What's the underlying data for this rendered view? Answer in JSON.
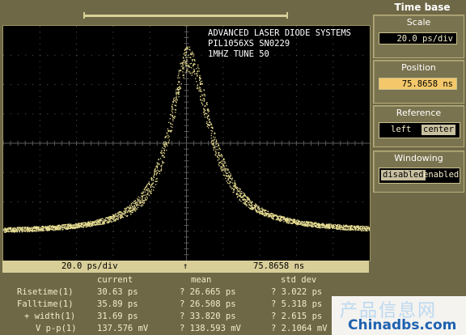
{
  "timebase": {
    "title": "Time base",
    "scale": {
      "label": "Scale",
      "value": "20.0 ps/div"
    },
    "position": {
      "label": "Position",
      "value": "75.8658 ns"
    },
    "reference": {
      "label": "Reference",
      "left": "left",
      "center": "center",
      "selected": "center"
    },
    "windowing": {
      "label": "Windowing",
      "disabled": "disabled",
      "enabled": "enabled",
      "selected": "disabled"
    }
  },
  "screen": {
    "banner": "ADVANCED LASER DIODE SYSTEMS\nPIL1056XS SN0229\n1MHZ TUNE 50",
    "trace_color": "#e7dc92",
    "grid_color": "#5a5a5a"
  },
  "statusbar": {
    "scale": "20.0 ps/div",
    "arrow": "↑",
    "position": "75.8658 ns"
  },
  "measurements": {
    "headers": {
      "current": "current",
      "mean": "mean",
      "std_dev": "std dev"
    },
    "rows": [
      {
        "name": "Risetime(1)",
        "current": "30.63 ps",
        "mean": "? 26.665 ps",
        "std": "? 3.022 ps"
      },
      {
        "name": "Falltime(1)",
        "current": "35.89 ps",
        "mean": "? 26.508 ps",
        "std": "? 5.318 ps"
      },
      {
        "name": "+ width(1)",
        "current": "31.69 ps",
        "mean": "? 33.820 ps",
        "std": "? 2.615 ps"
      },
      {
        "name": "V p-p(1)",
        "current": "137.576 mV",
        "mean": "? 138.593 mV",
        "std": "? 2.1064 mV"
      }
    ]
  },
  "watermark": {
    "line1": "产品信息网",
    "line2": "Chinadbs.com"
  }
}
